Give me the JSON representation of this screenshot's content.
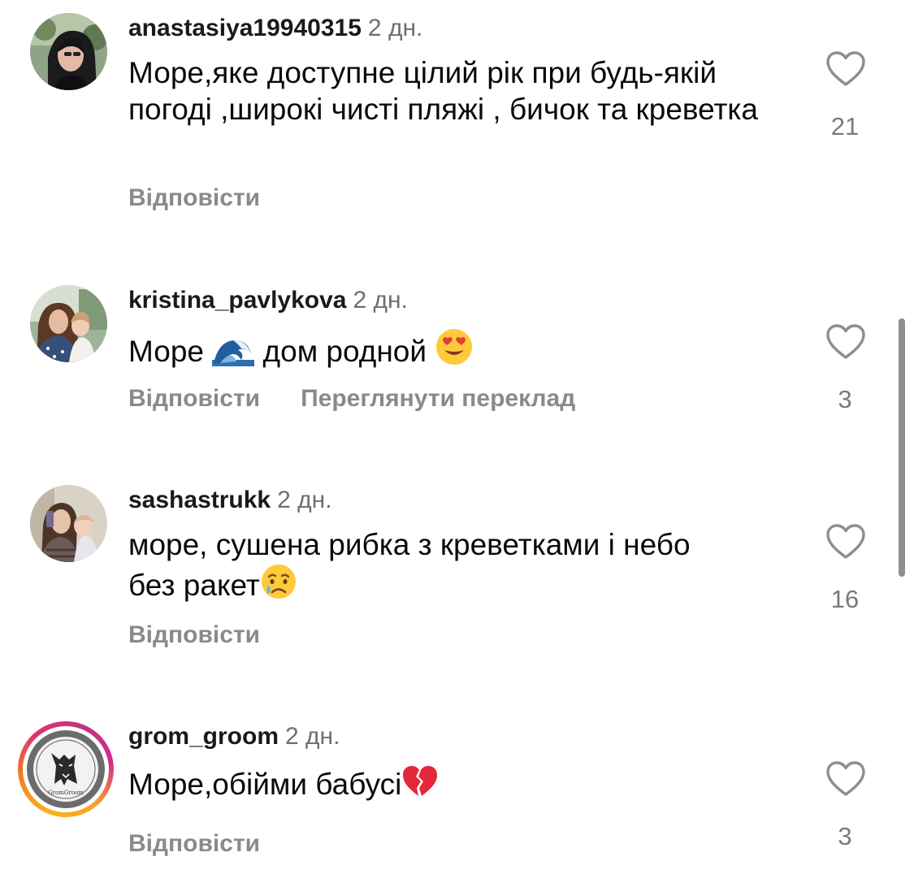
{
  "comments": [
    {
      "username": "anastasiya19940315",
      "time": "2 дн.",
      "text": "Море,яке доступне цілий рік при будь-якій погоді ,широкі чисті пляжі , бичок та креветка",
      "reply_label": "Відповісти",
      "likes": "21",
      "avatar": "woman-with-dark-hair-photo"
    },
    {
      "username": "kristina_pavlykova",
      "time": "2 дн.",
      "text_before": "Море",
      "text_after": "дом родной",
      "emojis": [
        "wave-emoji",
        "heart-eyes-emoji"
      ],
      "reply_label": "Відповісти",
      "translate_label": "Переглянути переклад",
      "likes": "3",
      "avatar": "woman-with-child-photo"
    },
    {
      "username": "sashastrukk",
      "time": "2 дн.",
      "text_line1": "море, сушена рибка з креветками і небо",
      "text_line2": "без ракет",
      "emojis": [
        "crying-face-emoji"
      ],
      "reply_label": "Відповісти",
      "likes": "16",
      "avatar": "mirror-selfie-with-baby-photo"
    },
    {
      "username": "grom_groom",
      "time": "2 дн.",
      "text": "Море,обійми бабусі",
      "emojis": [
        "broken-heart-emoji"
      ],
      "reply_label": "Відповісти",
      "likes": "3",
      "avatar": "gromgroom-dog-logo",
      "avatar_logo_text": "GromGroom",
      "has_story_ring": true
    }
  ],
  "colors": {
    "username": "#1a1a1a",
    "secondary_text": "#8a8a8a",
    "like_icon": "#8e8e8e",
    "story_ring": "#e1306c"
  },
  "icons": {
    "like": "heart-outline-icon"
  }
}
